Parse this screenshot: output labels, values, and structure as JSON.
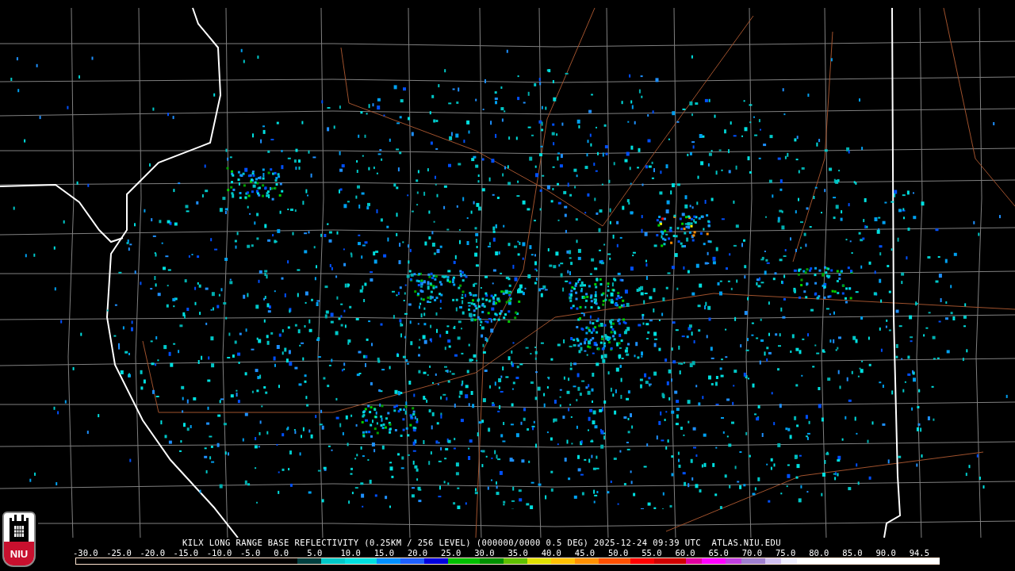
{
  "logo": {
    "text": "NIU"
  },
  "caption": "KILX LONG RANGE BASE REFLECTIVITY (0.25KM / 256 LEVEL) (000000/0000 0.5 DEG) 2025-12-24 09:39 UTC  ATLAS.NIU.EDU",
  "legend": {
    "ticks": [
      "-30.0",
      "-25.0",
      "-20.0",
      "-15.0",
      "-10.0",
      "-5.0",
      "0.0",
      "5.0",
      "10.0",
      "15.0",
      "20.0",
      "25.0",
      "30.0",
      "35.0",
      "40.0",
      "45.0",
      "50.0",
      "55.0",
      "60.0",
      "65.0",
      "70.0",
      "75.0",
      "80.0",
      "85.0",
      "90.0",
      "94.5"
    ]
  }
}
